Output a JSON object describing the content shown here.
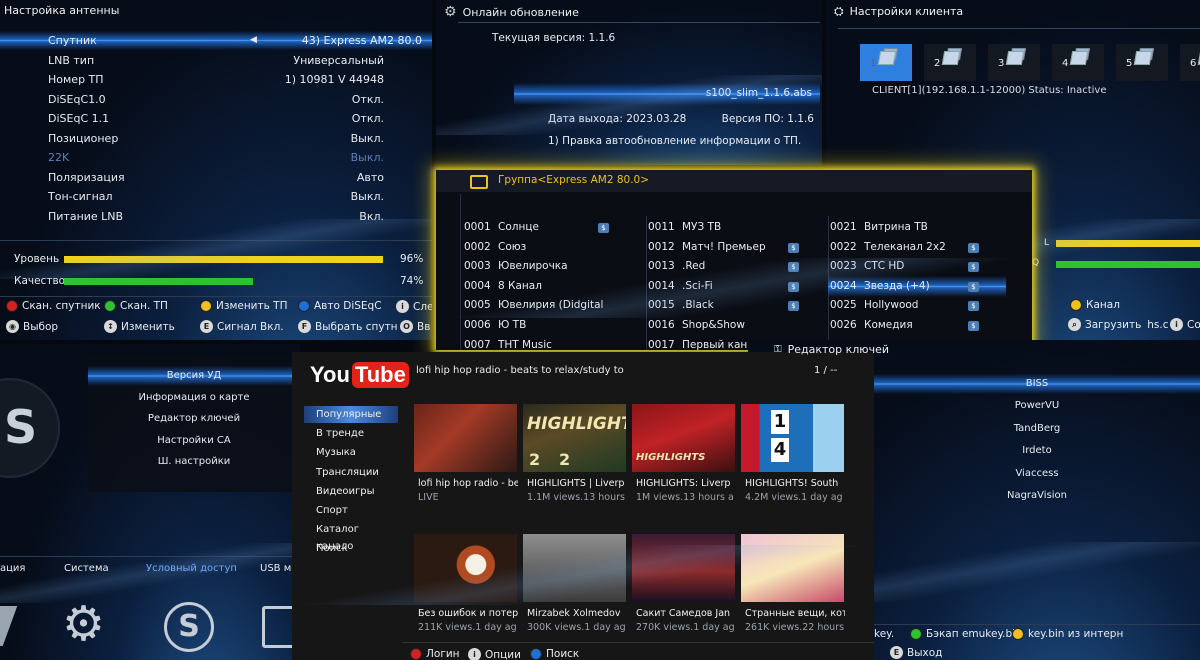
{
  "antenna": {
    "title": "Настройка антенны",
    "rows": [
      {
        "label": "Спутник",
        "value": "43) Express AM2 80.0",
        "selected": true
      },
      {
        "label": "LNB тип",
        "value": "Универсальный"
      },
      {
        "label": "Номер ТП",
        "value": "1) 10981 V 44948"
      },
      {
        "label": "DiSEqC1.0",
        "value": "Откл."
      },
      {
        "label": "DiSEqC 1.1",
        "value": "Откл."
      },
      {
        "label": "Позиционер",
        "value": "Выкл."
      },
      {
        "label": "22K",
        "value": "Выкл.",
        "dim": true
      },
      {
        "label": "Поляризация",
        "value": "Авто"
      },
      {
        "label": "Тон-сигнал",
        "value": "Выкл."
      },
      {
        "label": "Питание LNB",
        "value": "Вкл."
      }
    ],
    "level_label": "Уровень",
    "level_value": "96%",
    "level": 0.96,
    "quality_label": "Качество",
    "quality_value": "74%",
    "quality": 0.74,
    "hints": [
      "Скан. спутник",
      "Скан. ТП",
      "Изменить ТП",
      "Авто DiSEqC",
      "Сле",
      "Выбор",
      "Изменить",
      "Сигнал Вкл.",
      "Выбрать спутн",
      "Вв"
    ]
  },
  "update": {
    "title": "Онлайн обновление",
    "current_version": "Текущая версия: 1.1.6",
    "file": "s100_slim_1.1.6.abs",
    "release_date": "Дата выхода: 2023.03.28",
    "sw_version": "Версия ПО: 1.1.6",
    "notes": "1) Правка автообновление информации о ТП."
  },
  "client": {
    "title": "Настройки клиента",
    "tiles": [
      "1",
      "2",
      "3",
      "4",
      "5",
      "6"
    ],
    "status": "CLIENT[1](192.168.1.1-12000) Status: Inactive",
    "bar_labels": [
      "L",
      "Q"
    ],
    "hints": [
      "Канал",
      "Загрузить",
      "hs.c",
      "Co"
    ]
  },
  "channels": {
    "group": "Группа<Express AM2 80.0>",
    "col1": [
      {
        "num": "0001",
        "name": "Солнце",
        "paid": true
      },
      {
        "num": "0002",
        "name": "Союз"
      },
      {
        "num": "0003",
        "name": "Ювелирочка"
      },
      {
        "num": "0004",
        "name": "8 Канал"
      },
      {
        "num": "0005",
        "name": "Ювелирия (Didgital"
      },
      {
        "num": "0006",
        "name": "Ю ТВ"
      },
      {
        "num": "0007",
        "name": "ТНТ Music"
      }
    ],
    "col2": [
      {
        "num": "0011",
        "name": "МУЗ ТВ"
      },
      {
        "num": "0012",
        "name": "Матч! Премьер",
        "paid": true
      },
      {
        "num": "0013",
        "name": ".Red",
        "paid": true
      },
      {
        "num": "0014",
        "name": ".Sci-Fi",
        "paid": true
      },
      {
        "num": "0015",
        "name": ".Black",
        "paid": true
      },
      {
        "num": "0016",
        "name": "Shop&Show"
      },
      {
        "num": "0017",
        "name": "Первый кан"
      }
    ],
    "col3": [
      {
        "num": "0021",
        "name": "Витрина ТВ"
      },
      {
        "num": "0022",
        "name": "Телеканал 2х2",
        "paid": true
      },
      {
        "num": "0023",
        "name": "СТС HD",
        "paid": true
      },
      {
        "num": "0024",
        "name": "Звезда (+4)",
        "paid": true,
        "selected": true
      },
      {
        "num": "0025",
        "name": "Hollywood",
        "paid": true
      },
      {
        "num": "0026",
        "name": "Комедия",
        "paid": true
      }
    ],
    "dollar": "$"
  },
  "ca_menu": {
    "items": [
      "Версия УД",
      "Информация о карте",
      "Редактор ключей",
      "Настройки СА",
      "Ш. настройки"
    ],
    "tabs": [
      "ация",
      "Система",
      "Условный доступ",
      "USB м"
    ],
    "active_tab": "Условный доступ"
  },
  "youtube": {
    "logo_you": "You",
    "logo_tube": "Tube",
    "now_title": "lofi hip hop radio - beats to relax/study to",
    "page": "1 / --",
    "nav": [
      "Популярные",
      "В тренде",
      "Музыка",
      "Трансляции",
      "Видеоигры",
      "Спорт",
      "Каталог канало",
      "Поиск"
    ],
    "videos": [
      {
        "title": "lofi hip hop radio - be",
        "meta": "LIVE"
      },
      {
        "title": "HIGHLIGHTS | Liverp",
        "meta": "1.1M views.13 hours"
      },
      {
        "title": "HIGHLIGHTS: Liverp",
        "meta": "1M views.13 hours a"
      },
      {
        "title": "HIGHLIGHTS! South",
        "meta": "4.2M views.1 day ag"
      },
      {
        "title": "Без ошибок и потер",
        "meta": "211K views.1 day ag"
      },
      {
        "title": "Mirzabek Xolmedov",
        "meta": "300K views.1 day ag"
      },
      {
        "title": "Сакит Самедов Jan",
        "meta": "270K views.1 day ag"
      },
      {
        "title": "Странные вещи, кот",
        "meta": "261K views.22 hours"
      }
    ],
    "thumb_text_highlights": "HIGHLIGHTS",
    "thumb_score": [
      "2",
      "2"
    ],
    "thumb_score2": [
      "1",
      "4"
    ],
    "hints": [
      "Логин",
      "Опции",
      "Поиск"
    ]
  },
  "keys": {
    "title": "Редактор ключей",
    "items": [
      "BISS",
      "PowerVU",
      "TandBerg",
      "Irdeto",
      "Viaccess",
      "NagraVision"
    ],
    "hints": [
      "key.",
      "Бэкап emukey.bin",
      "key.bin из интерн",
      "Выход"
    ]
  },
  "colors": {
    "yellow": "#f0d020",
    "green": "#2ec22e",
    "red": "#d42020",
    "blue": "#1f6fd6",
    "accent": "#4aa3ff"
  }
}
